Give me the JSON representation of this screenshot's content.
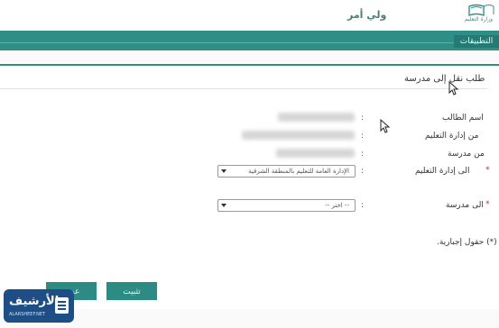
{
  "header": {
    "user_role": "ولي أمر",
    "ministry_name": "وزارة التعليم"
  },
  "appsbar": {
    "tab_label": "التطبيقات"
  },
  "page": {
    "title": "طلب نقل إلى مدرسة"
  },
  "form": {
    "fields": [
      {
        "label": "اسم الطالب"
      },
      {
        "label": "من إدارة التعليم"
      },
      {
        "label": "من مدرسة"
      },
      {
        "label": "الى إدارة التعليم",
        "required_mark": "*",
        "selected": "الإدارة العامة للتعليم بالمنطقة الشرقية"
      },
      {
        "label": "الى مدرسة",
        "required_mark": "*",
        "selected": "-- اختر --"
      }
    ],
    "colon": ":",
    "required_note": "(*) حقول إجبارية."
  },
  "buttons": {
    "save_label": "تثبيت",
    "back_label": "عودة"
  },
  "watermark": {
    "text": "الأرشيف",
    "sub": "ALARSHEEF.NET"
  },
  "colors": {
    "accent": "#2f8f86",
    "required": "#c0392b"
  }
}
